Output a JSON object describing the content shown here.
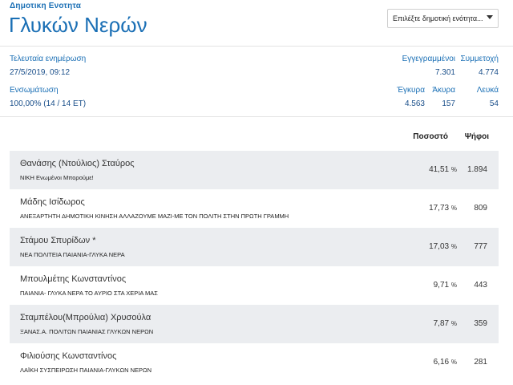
{
  "header": {
    "unit_label": "Δημοτικη Ενοτητα",
    "unit_name": "Γλυκών Νερών",
    "select_placeholder": "Επιλέξτε δημοτική ενότητα..."
  },
  "info": {
    "last_update_label": "Τελευταία ενημέρωση",
    "last_update_value": "27/5/2019, 09:12",
    "registered_label": "Εγγεγραμμένοι",
    "registered_value": "7.301",
    "turnout_label": "Συμμετοχή",
    "turnout_value": "4.774",
    "integration_label": "Ενσωμάτωση",
    "integration_value": "100,00% (14 / 14 ΕΤ)",
    "valid_label": "Έγκυρα",
    "valid_value": "4.563",
    "invalid_label": "Άκυρα",
    "invalid_value": "157",
    "blank_label": "Λευκά",
    "blank_value": "54"
  },
  "table": {
    "col_percent": "Ποσοστό",
    "col_votes": "Ψήφοι",
    "percent_unit": "%",
    "rows": [
      {
        "candidate": "Θανάσης (Ντούλιος) Σταύρος",
        "party": "ΝΙΚΗ Ενωμένοι Μπορούμε!",
        "percent": "41,51",
        "votes": "1.894"
      },
      {
        "candidate": "Μάδης Ισίδωρος",
        "party": "ΑΝΕΞΑΡΤΗΤΗ ΔΗΜΟΤΙΚΗ ΚΙΝΗΣΗ ΑΛΛΑΖΟΥΜΕ ΜΑΖΙ-ΜΕ ΤΟΝ ΠΟΛΙΤΗ ΣΤΗΝ ΠΡΩΤΗ ΓΡΑΜΜΗ",
        "percent": "17,73",
        "votes": "809"
      },
      {
        "candidate": "Στάμου Σπυρίδων *",
        "party": "ΝΕΑ ΠΟΛΙΤΕΙΑ ΠΑΙΑΝΙΑ-ΓΛΥΚΑ ΝΕΡΑ",
        "percent": "17,03",
        "votes": "777"
      },
      {
        "candidate": "Μπουλμέτης Κωνσταντίνος",
        "party": "ΠΑΙΑΝΙΑ- ΓΛΥΚΑ ΝΕΡΑ ΤΟ ΑΥΡΙΟ ΣΤΑ ΧΕΡΙΑ ΜΑΣ",
        "percent": "9,71",
        "votes": "443"
      },
      {
        "candidate": "Σταμπέλου(Μπρούλια) Χρυσούλα",
        "party": "ΞΑΝΑΣ.Α. ΠΟΛΙΤΩΝ ΠΑΙΑΝΙΑΣ ΓΛΥΚΩΝ ΝΕΡΩΝ",
        "percent": "7,87",
        "votes": "359"
      },
      {
        "candidate": "Φιλιούσης Κωνσταντίνος",
        "party": "ΛΑΪΚΗ ΣΥΣΠΕΙΡΩΣΗ ΠΑΙΑΝΙΑ-ΓΛΥΚΩΝ ΝΕΡΩΝ",
        "percent": "6,16",
        "votes": "281"
      }
    ]
  }
}
